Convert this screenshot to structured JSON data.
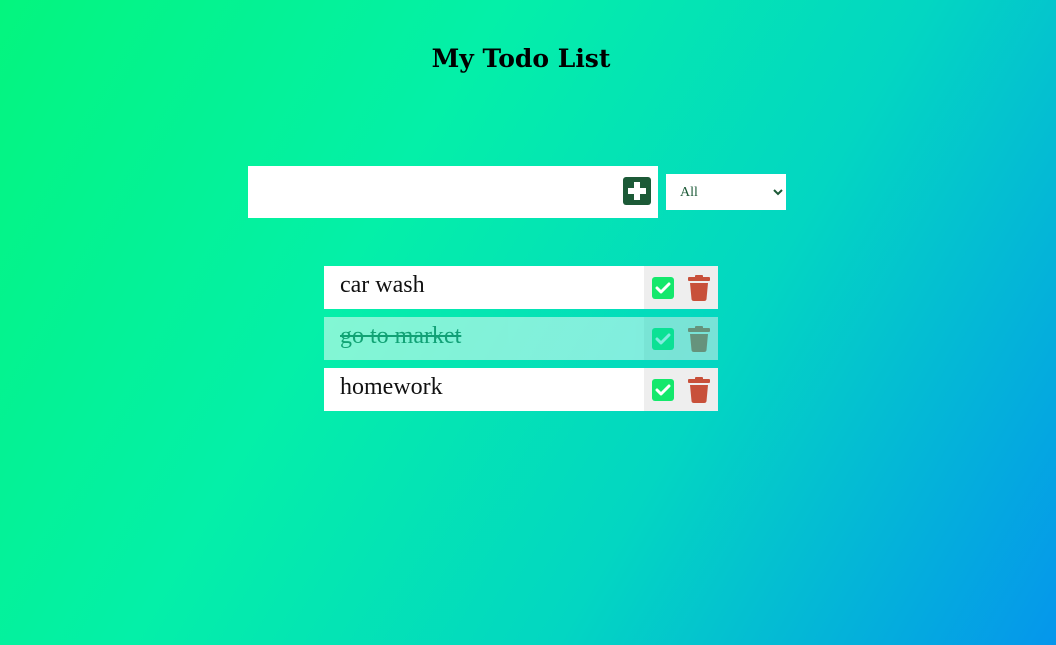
{
  "header": {
    "title": "My Todo List"
  },
  "form": {
    "input_value": "",
    "add_icon": "plus-square-icon",
    "filter": {
      "selected": "All",
      "options": [
        "All"
      ]
    }
  },
  "todos": [
    {
      "text": "car wash",
      "completed": false
    },
    {
      "text": "go to market",
      "completed": true
    },
    {
      "text": "homework",
      "completed": false
    }
  ],
  "icons": {
    "complete": "check-square-icon",
    "delete": "trash-icon"
  },
  "colors": {
    "accent_dark_green": "#1c5a37",
    "check_green": "#14e86c",
    "trash_red": "#c8503a",
    "gradient_start": "#04f57e",
    "gradient_end": "#0596ec"
  }
}
